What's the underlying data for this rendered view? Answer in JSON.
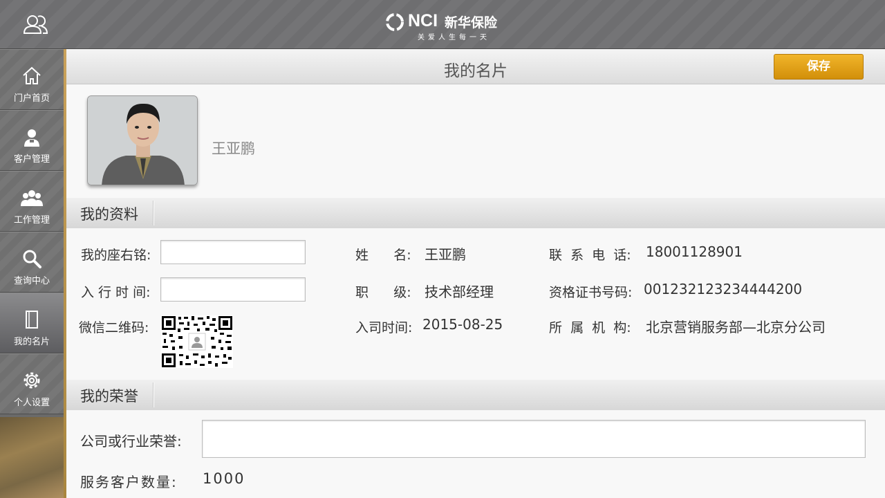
{
  "header": {
    "logo_brand": "NCI",
    "logo_cn": "新华保险",
    "logo_slogan": "关爱人生每一天",
    "user_icon": "user-group-icon"
  },
  "sidebar": {
    "items": [
      {
        "label": "门户首页",
        "icon": "home-icon"
      },
      {
        "label": "客户管理",
        "icon": "customer-icon"
      },
      {
        "label": "工作管理",
        "icon": "team-icon"
      },
      {
        "label": "查询中心",
        "icon": "search-icon"
      },
      {
        "label": "我的名片",
        "icon": "card-icon",
        "active": true
      },
      {
        "label": "个人设置",
        "icon": "gear-icon"
      }
    ]
  },
  "page": {
    "title": "我的名片",
    "save_label": "保存",
    "profile_name": "王亚鹏"
  },
  "profile_section": {
    "title": "我的资料",
    "motto_label": "我的座右铭:",
    "motto_value": "",
    "entry_label": "入 行 时 间:",
    "entry_value": "",
    "wechat_label": "微信二维码:",
    "surname_label": "姓      名:",
    "surname_value": "王亚鹏",
    "rank_label": "职      级:",
    "rank_value": "技术部经理",
    "join_label": "入司时间:",
    "join_value": "2015-08-25",
    "phone_label": "联  系  电  话:",
    "phone_value": "18001128901",
    "cert_label": "资格证书号码:",
    "cert_value": "001232123234444200",
    "org_label": "所  属  机  构:",
    "org_value": "北京营销服务部—北京分公司"
  },
  "honor_section": {
    "title": "我的荣誉",
    "honor_label": "公司或行业荣誉:",
    "honor_value": "",
    "clients_label": "服务客户数量:",
    "clients_value": "1000"
  },
  "colors": {
    "save_button": "#e0a010",
    "sidebar": "#707070",
    "accent_gold": "#c9a15a"
  }
}
